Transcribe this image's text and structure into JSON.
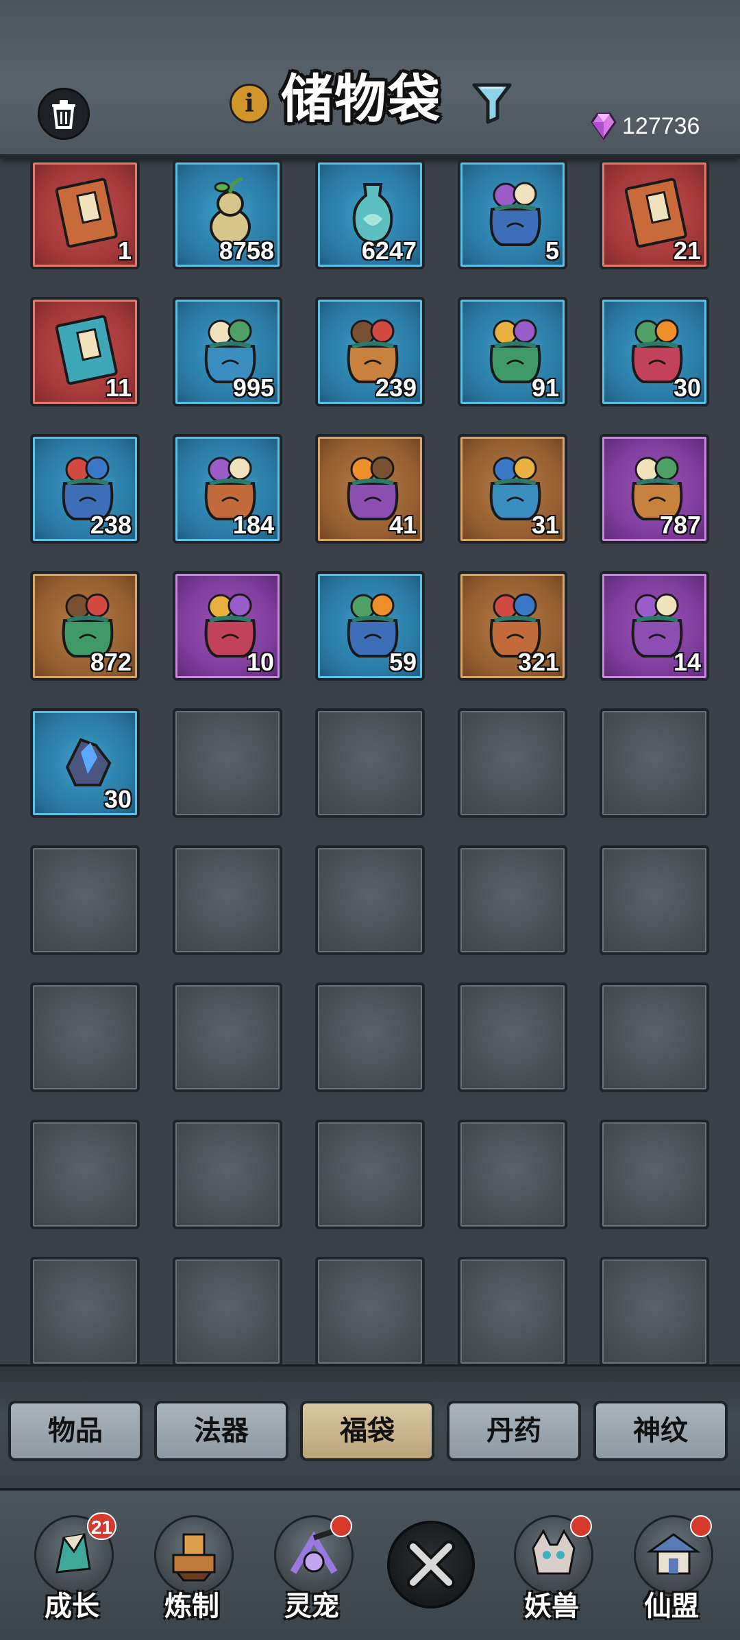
{
  "header": {
    "title": "储物袋",
    "currency": {
      "icon": "purple-gem-icon",
      "value": "127736"
    }
  },
  "grid": {
    "slots": [
      {
        "item": "red-scroll-book",
        "rarity": "red",
        "qty": "1"
      },
      {
        "item": "gourd-sprout",
        "rarity": "blue",
        "qty": "8758"
      },
      {
        "item": "jade-vase",
        "rarity": "blue",
        "qty": "6247"
      },
      {
        "item": "pouch-bread",
        "rarity": "blue",
        "qty": "5"
      },
      {
        "item": "dao-book",
        "rarity": "red",
        "qty": "21"
      },
      {
        "item": "de-book",
        "rarity": "red",
        "qty": "11"
      },
      {
        "item": "pouch-red-purple",
        "rarity": "blue",
        "qty": "995"
      },
      {
        "item": "pouch-orange-fruit",
        "rarity": "blue",
        "qty": "239"
      },
      {
        "item": "pouch-ore",
        "rarity": "blue",
        "qty": "91"
      },
      {
        "item": "pouch-green-ore",
        "rarity": "blue",
        "qty": "30"
      },
      {
        "item": "pouch-purple-gems",
        "rarity": "blue",
        "qty": "238"
      },
      {
        "item": "pouch-papers",
        "rarity": "blue",
        "qty": "184"
      },
      {
        "item": "pouch-scrolls",
        "rarity": "orange",
        "qty": "41"
      },
      {
        "item": "pouch-scrolls-2",
        "rarity": "orange",
        "qty": "31"
      },
      {
        "item": "pouch-fruit-purple",
        "rarity": "purple",
        "qty": "787"
      },
      {
        "item": "pouch-red-green",
        "rarity": "orange",
        "qty": "872"
      },
      {
        "item": "pouch-orbs",
        "rarity": "purple",
        "qty": "10"
      },
      {
        "item": "pouch-stones",
        "rarity": "blue",
        "qty": "59"
      },
      {
        "item": "pouch-orbs-2",
        "rarity": "orange",
        "qty": "321"
      },
      {
        "item": "pouch-colored-orbs",
        "rarity": "purple",
        "qty": "14"
      },
      {
        "item": "spirit-crystal",
        "rarity": "blue",
        "qty": "30"
      }
    ],
    "total_slots": 45
  },
  "tabs": [
    {
      "label": "物品",
      "active": false
    },
    {
      "label": "法器",
      "active": false
    },
    {
      "label": "福袋",
      "active": true
    },
    {
      "label": "丹药",
      "active": false
    },
    {
      "label": "神纹",
      "active": false
    }
  ],
  "bottom_nav": [
    {
      "label": "成长",
      "icon": "growth-icon",
      "badge": "21",
      "dot": false
    },
    {
      "label": "炼制",
      "icon": "forge-icon",
      "badge": "",
      "dot": false
    },
    {
      "label": "灵宠",
      "icon": "spirit-pet-icon",
      "badge": "",
      "dot": true
    },
    {
      "label": "",
      "icon": "close-icon",
      "badge": "",
      "dot": false
    },
    {
      "label": "妖兽",
      "icon": "demon-beast-icon",
      "badge": "",
      "dot": true
    },
    {
      "label": "仙盟",
      "icon": "alliance-icon",
      "badge": "",
      "dot": true
    }
  ],
  "colors": {
    "rarity_blue": "#2a7aa4",
    "rarity_red": "#a4383a",
    "rarity_orange": "#955f31",
    "rarity_purple": "#7d3c9b",
    "badge_red": "#d63a2c",
    "tab_active": "#c9b48a"
  }
}
